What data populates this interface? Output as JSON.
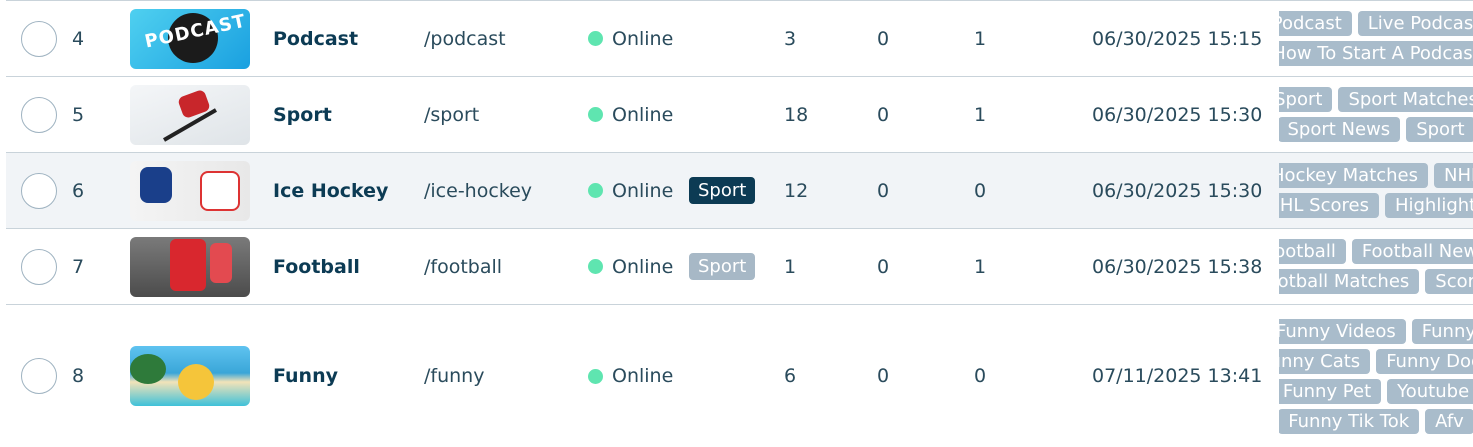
{
  "rows": [
    {
      "num": "4",
      "name": "Podcast",
      "path": "/podcast",
      "status": "Online",
      "parent": "",
      "count1": "3",
      "count2": "0",
      "count3": "1",
      "date": "06/30/2025 15:15",
      "tags": [
        [
          "Podcast",
          "Live Podcast"
        ],
        [
          "How To Start A Podcast"
        ]
      ],
      "thumb": "podcast-thumbnail"
    },
    {
      "num": "5",
      "name": "Sport",
      "path": "/sport",
      "status": "Online",
      "parent": "",
      "count1": "18",
      "count2": "0",
      "count3": "1",
      "date": "06/30/2025 15:30",
      "tags": [
        [
          "Sport",
          "Sport Matches"
        ],
        [
          "Sport News",
          "Sport"
        ]
      ],
      "thumb": "skier-thumbnail"
    },
    {
      "num": "6",
      "name": "Ice Hockey",
      "path": "/ice-hockey",
      "status": "Online",
      "parent": "Sport",
      "count1": "12",
      "count2": "0",
      "count3": "0",
      "date": "06/30/2025 15:30",
      "tags": [
        [
          "Hockey Matches",
          "NHL"
        ],
        [
          "NHL Scores",
          "Highlights"
        ]
      ],
      "thumb": "hockey-thumbnail"
    },
    {
      "num": "7",
      "name": "Football",
      "path": "/football",
      "status": "Online",
      "parent": "Sport",
      "count1": "1",
      "count2": "0",
      "count3": "1",
      "date": "06/30/2025 15:38",
      "tags": [
        [
          "Football",
          "Football News"
        ],
        [
          "Football Matches",
          "Scores"
        ]
      ],
      "thumb": "football-thumbnail"
    },
    {
      "num": "8",
      "name": "Funny",
      "path": "/funny",
      "status": "Online",
      "parent": "",
      "count1": "6",
      "count2": "0",
      "count3": "0",
      "date": "07/11/2025 13:41",
      "tags": [
        [
          "Funny Videos",
          "Funny"
        ],
        [
          "Funny Cats",
          "Funny Dogs"
        ],
        [
          "Funny Pet",
          "Youtube"
        ],
        [
          "Funny Tik Tok",
          "Afv"
        ]
      ],
      "thumb": "beach-thumbnail"
    }
  ],
  "colors": {
    "online_dot": "#5fe5b0",
    "parent_active": "#0c3b54",
    "parent_inactive": "#a7b8c6",
    "tag": "#a9bccb",
    "highlight_row": "#f1f4f7"
  }
}
